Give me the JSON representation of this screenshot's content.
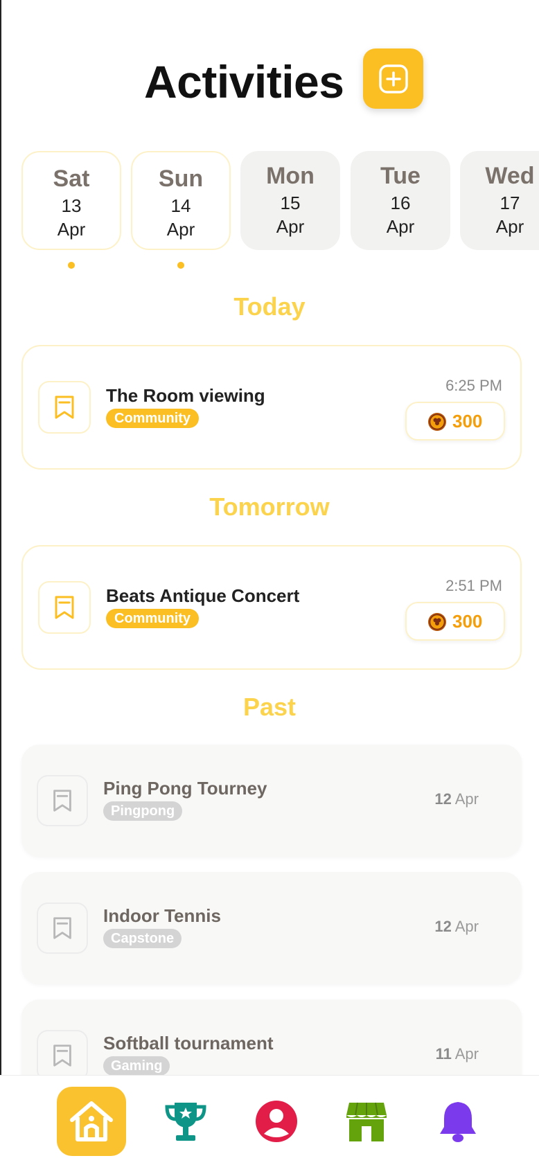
{
  "header": {
    "title": "Activities",
    "add_icon": "plus-square-icon"
  },
  "days": [
    {
      "dow": "Sat",
      "day": "13",
      "month": "Apr",
      "active": true,
      "has_event": true
    },
    {
      "dow": "Sun",
      "day": "14",
      "month": "Apr",
      "active": true,
      "has_event": true
    },
    {
      "dow": "Mon",
      "day": "15",
      "month": "Apr",
      "active": false,
      "has_event": false
    },
    {
      "dow": "Tue",
      "day": "16",
      "month": "Apr",
      "active": false,
      "has_event": false
    },
    {
      "dow": "Wed",
      "day": "17",
      "month": "Apr",
      "active": false,
      "has_event": false
    }
  ],
  "sections": {
    "today": "Today",
    "tomorrow": "Tomorrow",
    "past": "Past"
  },
  "today_events": [
    {
      "name": "The Room viewing",
      "tag": "Community",
      "time": "6:25 PM",
      "points": "300",
      "icon": "bookmark-icon"
    }
  ],
  "tomorrow_events": [
    {
      "name": "Beats Antique Concert",
      "tag": "Community",
      "time": "2:51 PM",
      "points": "300",
      "icon": "bookmark-icon"
    }
  ],
  "past_events": [
    {
      "name": "Ping Pong Tourney",
      "tag": "Pingpong",
      "date_day": "12",
      "date_month": "Apr"
    },
    {
      "name": "Indoor Tennis",
      "tag": "Capstone",
      "date_day": "12",
      "date_month": "Apr"
    },
    {
      "name": "Softball tournament",
      "tag": "Gaming",
      "date_day": "11",
      "date_month": "Apr"
    }
  ],
  "nav": [
    {
      "name": "home",
      "icon": "home-icon",
      "color": "#fbbf24"
    },
    {
      "name": "trophy",
      "icon": "trophy-icon",
      "color": "#0f9488"
    },
    {
      "name": "profile",
      "icon": "user-icon",
      "color": "#e11d48"
    },
    {
      "name": "store",
      "icon": "store-icon",
      "color": "#65a30d"
    },
    {
      "name": "notifications",
      "icon": "bell-icon",
      "color": "#7c3aed"
    }
  ],
  "colors": {
    "accent": "#fbbf24",
    "accent_light": "#fcd34d",
    "points": "#f59e0b"
  }
}
